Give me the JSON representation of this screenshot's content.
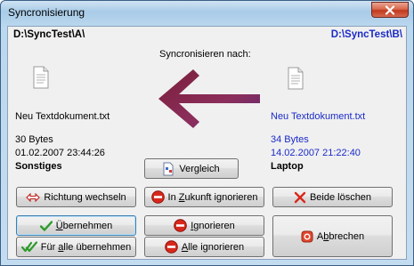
{
  "window": {
    "title": "Syncronisierung"
  },
  "paths": {
    "left": "D:\\SyncTest\\A\\",
    "right": "D:\\SyncTest\\B\\"
  },
  "sync_label": "Syncronisieren nach:",
  "left_file": {
    "name": "Neu Textdokument.txt",
    "size": "30 Bytes",
    "date": "01.02.2007 23:44:26",
    "category": "Sonstiges"
  },
  "right_file": {
    "name": "Neu Textdokument.txt",
    "size": "34 Bytes",
    "date": "14.02.2007 21:22:40",
    "category": "Laptop"
  },
  "colors": {
    "right_text": "#1a2bc8",
    "arrow": "#8a2a57"
  },
  "buttons": {
    "compare": "Vergleich",
    "change_direction": "Richtung wechseln",
    "ignore_future": {
      "pre": "In ",
      "key": "Z",
      "post": "ukunft ignorieren"
    },
    "delete_both": "Beide löschen",
    "accept": {
      "pre": "",
      "key": "Ü",
      "post": "bernehmen"
    },
    "ignore": {
      "pre": "",
      "key": "I",
      "post": "gnorieren"
    },
    "cancel": {
      "pre": "A",
      "key": "b",
      "post": "brechen"
    },
    "accept_all": {
      "pre": "Für ",
      "key": "a",
      "post": "lle übernehmen"
    },
    "ignore_all": {
      "pre": "",
      "key": "A",
      "post": "lle ignorieren"
    }
  }
}
